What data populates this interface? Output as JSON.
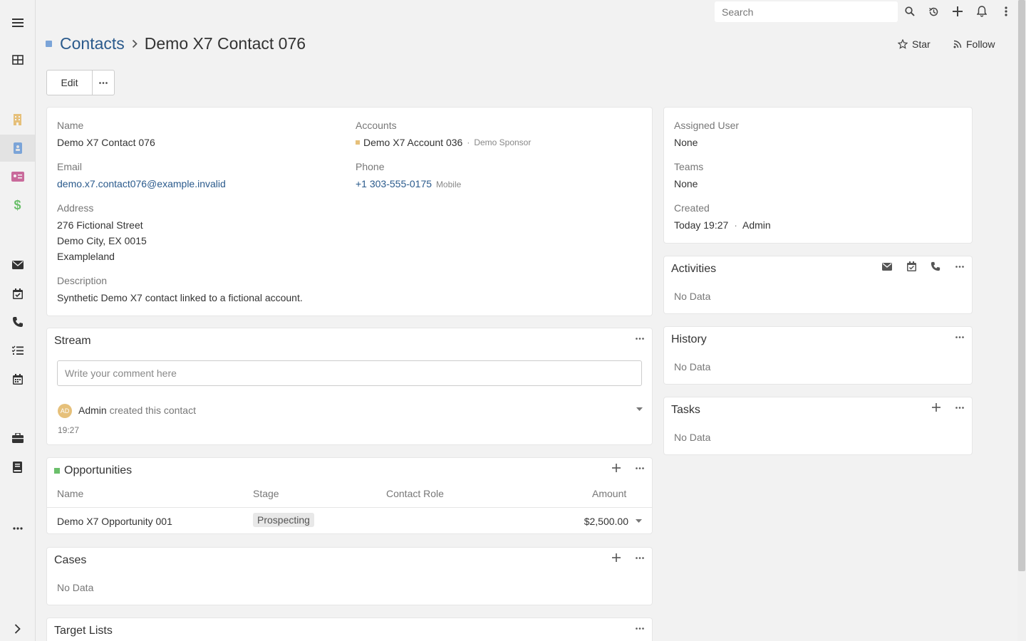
{
  "topbar": {
    "search_placeholder": "Search"
  },
  "header": {
    "module": "Contacts",
    "record": "Demo X7 Contact 076",
    "star_label": "Star",
    "follow_label": "Follow"
  },
  "actions": {
    "edit_label": "Edit"
  },
  "detail": {
    "name_label": "Name",
    "name_value": "Demo X7 Contact 076",
    "accounts_label": "Accounts",
    "account_name": "Demo X7 Account 036",
    "account_role": "Demo Sponsor",
    "email_label": "Email",
    "email_value": "demo.x7.contact076@example.invalid",
    "phone_label": "Phone",
    "phone_value": "+1 303-555-0175",
    "phone_type": "Mobile",
    "address_label": "Address",
    "address_line1": "276 Fictional Street",
    "address_line2": "Demo City, EX 0015",
    "address_line3": "Exampleland",
    "description_label": "Description",
    "description_value": "Synthetic Demo X7 contact linked to a fictional account."
  },
  "side": {
    "assigned_label": "Assigned User",
    "assigned_value": "None",
    "teams_label": "Teams",
    "teams_value": "None",
    "created_label": "Created",
    "created_time": "Today 19:27",
    "created_by": "Admin"
  },
  "activities": {
    "title": "Activities",
    "empty": "No Data"
  },
  "history": {
    "title": "History",
    "empty": "No Data"
  },
  "tasks": {
    "title": "Tasks",
    "empty": "No Data"
  },
  "stream": {
    "title": "Stream",
    "placeholder": "Write your comment here",
    "avatar_initials": "AD",
    "author": "Admin",
    "action": "created this contact",
    "time": "19:27"
  },
  "opportunities": {
    "title": "Opportunities",
    "columns": [
      "Name",
      "Stage",
      "Contact Role",
      "Amount"
    ],
    "rows": [
      {
        "name": "Demo X7 Opportunity 001",
        "stage": "Prospecting",
        "role": "",
        "amount": "$2,500.00"
      }
    ]
  },
  "cases": {
    "title": "Cases",
    "empty": "No Data"
  },
  "target_lists": {
    "title": "Target Lists"
  },
  "colors": {
    "link": "#2a5a8c",
    "contacts_dot": "#7ba4d8",
    "opportunity_dot": "#6bbf6b",
    "account_dot": "#e6c07a"
  }
}
